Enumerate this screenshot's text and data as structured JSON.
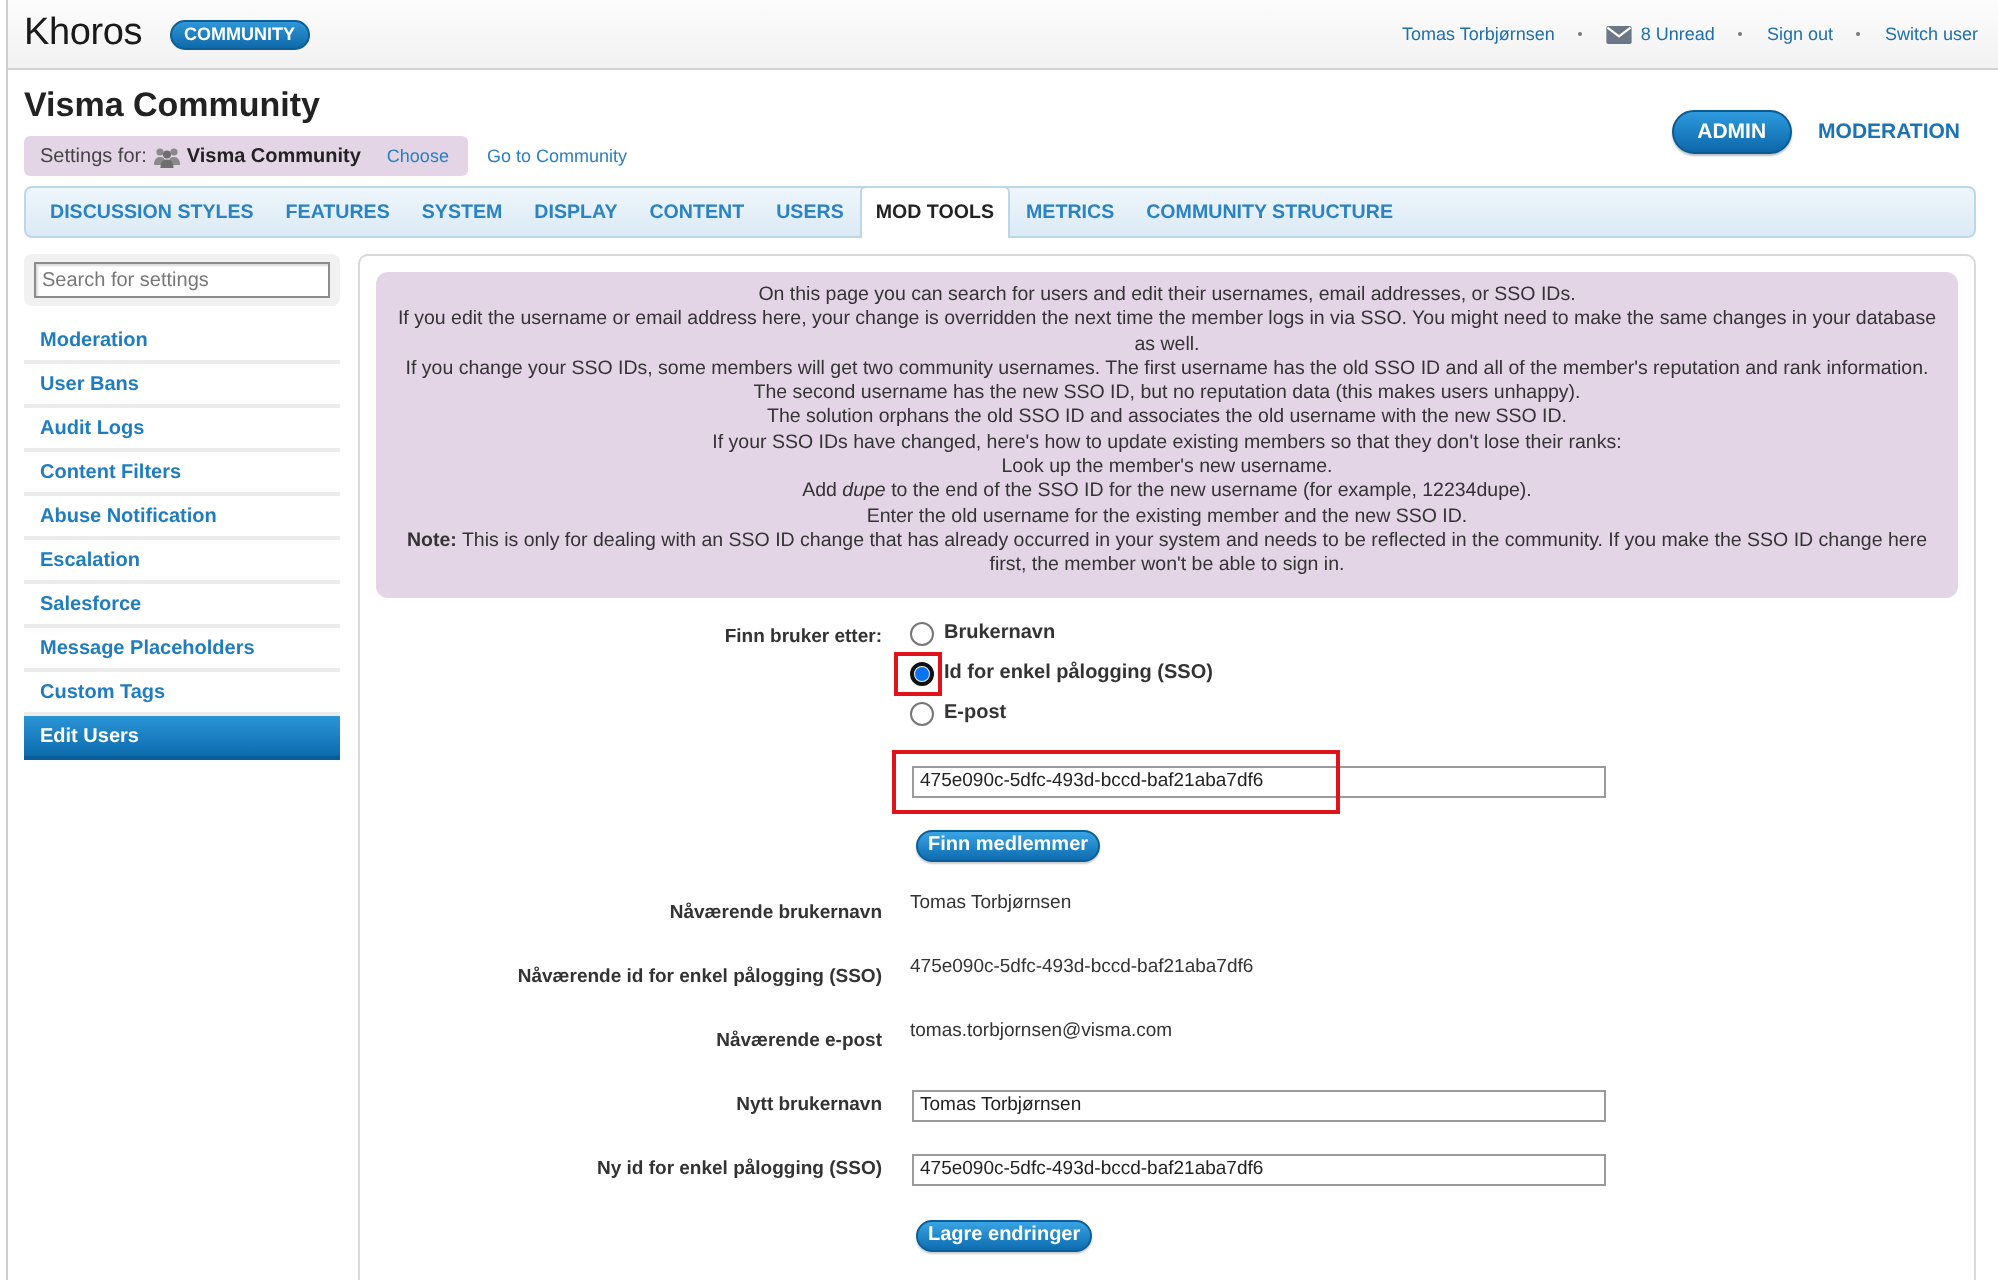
{
  "header": {
    "logo": "Khoros",
    "badge": "COMMUNITY",
    "links": [
      {
        "kind": "user",
        "label": "Tomas Torbjørnsen"
      },
      {
        "kind": "inbox",
        "label": "8 Unread"
      },
      {
        "kind": "link",
        "label": "Sign out"
      },
      {
        "kind": "link",
        "label": "Switch user"
      }
    ]
  },
  "title": "Visma Community",
  "settings_for": {
    "label": "Settings for:",
    "community": "Visma Community",
    "choose": "Choose"
  },
  "go_to_community": "Go to Community",
  "mode_buttons": [
    {
      "label": "ADMIN",
      "selected": true
    },
    {
      "label": "MODERATION",
      "selected": false
    }
  ],
  "tabs": [
    {
      "label": "DISCUSSION STYLES",
      "selected": false
    },
    {
      "label": "FEATURES",
      "selected": false
    },
    {
      "label": "SYSTEM",
      "selected": false
    },
    {
      "label": "DISPLAY",
      "selected": false
    },
    {
      "label": "CONTENT",
      "selected": false
    },
    {
      "label": "USERS",
      "selected": false
    },
    {
      "label": "MOD TOOLS",
      "selected": true
    },
    {
      "label": "METRICS",
      "selected": false
    },
    {
      "label": "COMMUNITY STRUCTURE",
      "selected": false
    }
  ],
  "sidebar": {
    "search": {
      "placeholder": "Search for settings"
    },
    "items": [
      {
        "label": "Moderation",
        "selected": false
      },
      {
        "label": "User Bans",
        "selected": false
      },
      {
        "label": "Audit Logs",
        "selected": false
      },
      {
        "label": "Content Filters",
        "selected": false
      },
      {
        "label": "Abuse Notification",
        "selected": false
      },
      {
        "label": "Escalation",
        "selected": false
      },
      {
        "label": "Salesforce",
        "selected": false
      },
      {
        "label": "Message Placeholders",
        "selected": false
      },
      {
        "label": "Custom Tags",
        "selected": false
      },
      {
        "label": "Edit Users",
        "selected": true
      }
    ]
  },
  "info": {
    "lines": [
      "On this page you can search for users and edit their usernames, email addresses, or SSO IDs.",
      "If you edit the username or email address here, your change is overridden the next time the member logs in via SSO. You might need to make the same changes in your database as well.",
      "If you change your SSO IDs, some members will get two community usernames. The first username has the old SSO ID and all of the member's reputation and rank information.",
      "The second username has the new SSO ID, but no reputation data (this makes users unhappy).",
      "The solution orphans the old SSO ID and associates the old username with the new SSO ID.",
      "If your SSO IDs have changed, here's how to update existing members so that they don't lose their ranks:",
      "Look up the member's new username.",
      "Add *dupe* to the end of the SSO ID for the new username (for example, 12234dupe).",
      "Enter the old username for the existing member and the new SSO ID.",
      "**Note:** This is only for dealing with an SSO ID change that has already occurred in your system and needs to be reflected in the community. If you make the SSO ID change here first, the member won't be able to sign in."
    ]
  },
  "form": {
    "search_by": {
      "label": "Finn bruker etter:",
      "options": [
        {
          "label": "Brukernavn",
          "selected": false,
          "focused": false,
          "highlighted": false
        },
        {
          "label": "Id for enkel pålogging (SSO)",
          "selected": true,
          "focused": true,
          "highlighted": true
        },
        {
          "label": "E-post",
          "selected": false,
          "focused": false,
          "highlighted": false
        }
      ]
    },
    "search_field": {
      "value": "475e090c-5dfc-493d-bccd-baf21aba7df6",
      "highlighted": true
    },
    "find_button": "Finn medlemmer",
    "fields": [
      {
        "kind": "display",
        "label": "Nåværende brukernavn",
        "value": "Tomas Torbjørnsen"
      },
      {
        "kind": "display",
        "label": "Nåværende id for enkel pålogging (SSO)",
        "value": "475e090c-5dfc-493d-bccd-baf21aba7df6"
      },
      {
        "kind": "display",
        "label": "Nåværende e-post",
        "value": "tomas.torbjornsen@visma.com"
      },
      {
        "kind": "input",
        "label": "Nytt brukernavn",
        "value": "Tomas Torbjørnsen"
      },
      {
        "kind": "input",
        "label": "Ny id for enkel pålogging (SSO)",
        "value": "475e090c-5dfc-493d-bccd-baf21aba7df6"
      }
    ],
    "save_button": "Lagre endringer"
  }
}
